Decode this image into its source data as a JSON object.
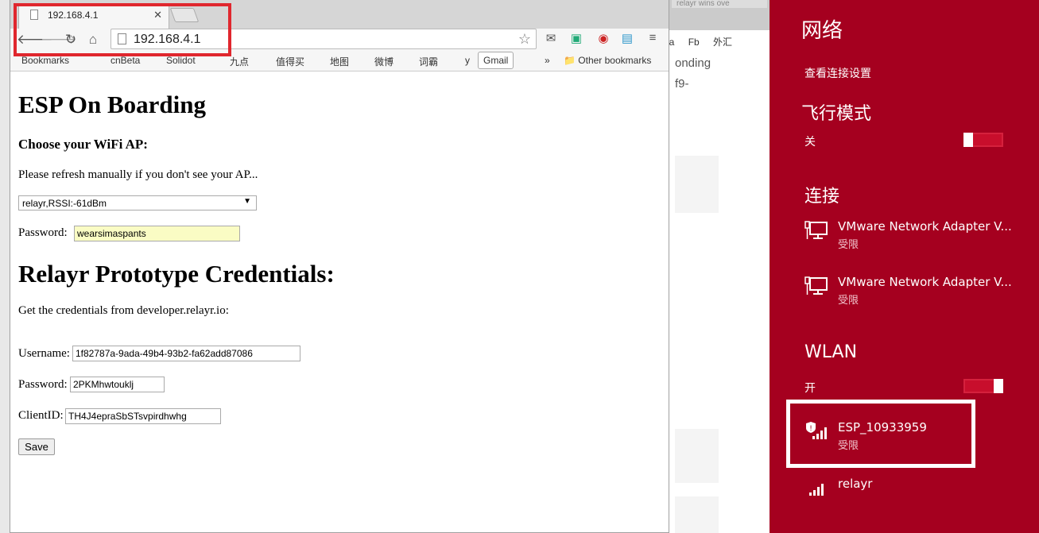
{
  "browser": {
    "tab_title": "192.168.4.1",
    "url": "192.168.4.1",
    "bookmarks": [
      "Bookmarks",
      "cnBeta",
      "Solidot",
      "九点",
      "值得买",
      "地图",
      "微博",
      "词霸",
      "y"
    ],
    "gmail_label": "Gmail",
    "more_label": "»",
    "other_bookmarks": "Other bookmarks"
  },
  "page": {
    "title": "ESP On Boarding",
    "choose_heading": "Choose your WiFi AP:",
    "refresh_note": "Please refresh manually if you don't see your AP...",
    "ap_selected": "relayr,RSSI:-61dBm",
    "password_label": "Password:",
    "password_value": "wearsimaspants",
    "cred_heading": "Relayr Prototype Credentials:",
    "cred_note": "Get the credentials from developer.relayr.io:",
    "username_label": "Username:",
    "username_value": "1f82787a-9ada-49b4-93b2-fa62add87086",
    "password2_label": "Password:",
    "password2_value": "2PKMhwtouklj",
    "clientid_label": "ClientID:",
    "clientid_value": "TH4J4epraSbSTsvpirdhwhg",
    "save_label": "Save"
  },
  "bg_window": {
    "tab_text": "relayr wins ove",
    "bookmarks": [
      "ia",
      "Fb",
      "外汇"
    ],
    "text_lines": [
      "onding",
      "f9-"
    ]
  },
  "network_panel": {
    "title": "网络",
    "view_settings": "查看连接设置",
    "airplane_heading": "飞行模式",
    "airplane_state": "关",
    "connections_heading": "连接",
    "adapters": [
      {
        "name": "VMware Network Adapter V...",
        "status": "受限"
      },
      {
        "name": "VMware Network Adapter V...",
        "status": "受限"
      }
    ],
    "wlan_heading": "WLAN",
    "wlan_state": "开",
    "wifi": [
      {
        "name": "ESP_10933959",
        "status": "受限"
      },
      {
        "name": "relayr",
        "status": ""
      }
    ]
  }
}
